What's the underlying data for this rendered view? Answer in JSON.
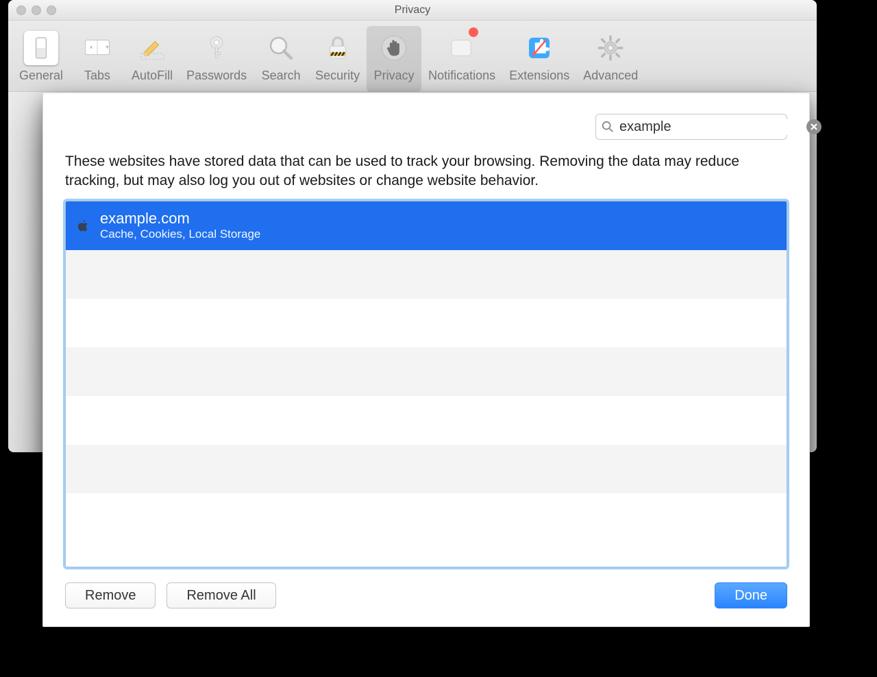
{
  "window": {
    "title": "Privacy"
  },
  "toolbar": {
    "general": "General",
    "tabs": "Tabs",
    "autofill": "AutoFill",
    "passwords": "Passwords",
    "search": "Search",
    "security": "Security",
    "privacy": "Privacy",
    "notifications": "Notifications",
    "extensions": "Extensions",
    "advanced": "Advanced",
    "selected": "privacy",
    "notifications_badge": true
  },
  "sheet": {
    "search_value": "example",
    "description": "These websites have stored data that can be used to track your browsing. Removing the data may reduce tracking, but may also log you out of websites or change website behavior.",
    "sites": [
      {
        "domain": "example.com",
        "detail": "Cache, Cookies, Local Storage",
        "selected": true
      }
    ],
    "remove_label": "Remove",
    "remove_all_label": "Remove All",
    "done_label": "Done"
  }
}
